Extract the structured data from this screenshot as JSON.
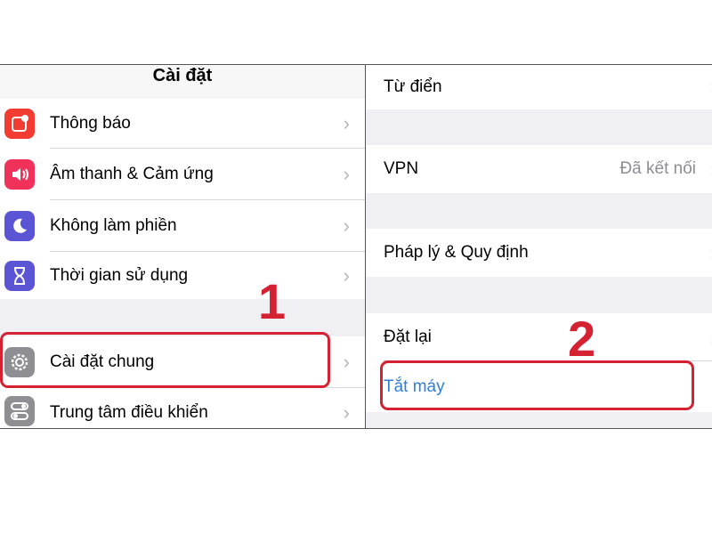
{
  "left": {
    "title": "Cài đặt",
    "items": [
      {
        "label": "Thông báo",
        "icon": "notification-icon",
        "color": "#f23c31"
      },
      {
        "label": "Âm thanh & Cảm ứng",
        "icon": "speaker-icon",
        "color": "#f0325a"
      },
      {
        "label": "Không làm phiền",
        "icon": "moon-icon",
        "color": "#5b55d6"
      },
      {
        "label": "Thời gian sử dụng",
        "icon": "hourglass-icon",
        "color": "#5b55d6"
      },
      {
        "label": "Cài đặt chung",
        "icon": "gear-icon",
        "color": "#8e8e93"
      },
      {
        "label": "Trung tâm điều khiển",
        "icon": "toggles-icon",
        "color": "#8e8e93"
      }
    ],
    "step_number": "1"
  },
  "right": {
    "items": [
      {
        "label": "Từ điển"
      },
      {
        "label": "VPN",
        "value": "Đã kết nối"
      },
      {
        "label": "Pháp lý & Quy định"
      },
      {
        "label": "Đặt lại"
      },
      {
        "label": "Tắt máy"
      }
    ],
    "step_number": "2"
  },
  "colors": {
    "highlight": "#d42233",
    "link": "#2f7fd6",
    "chevron": "#b5b5ba"
  }
}
